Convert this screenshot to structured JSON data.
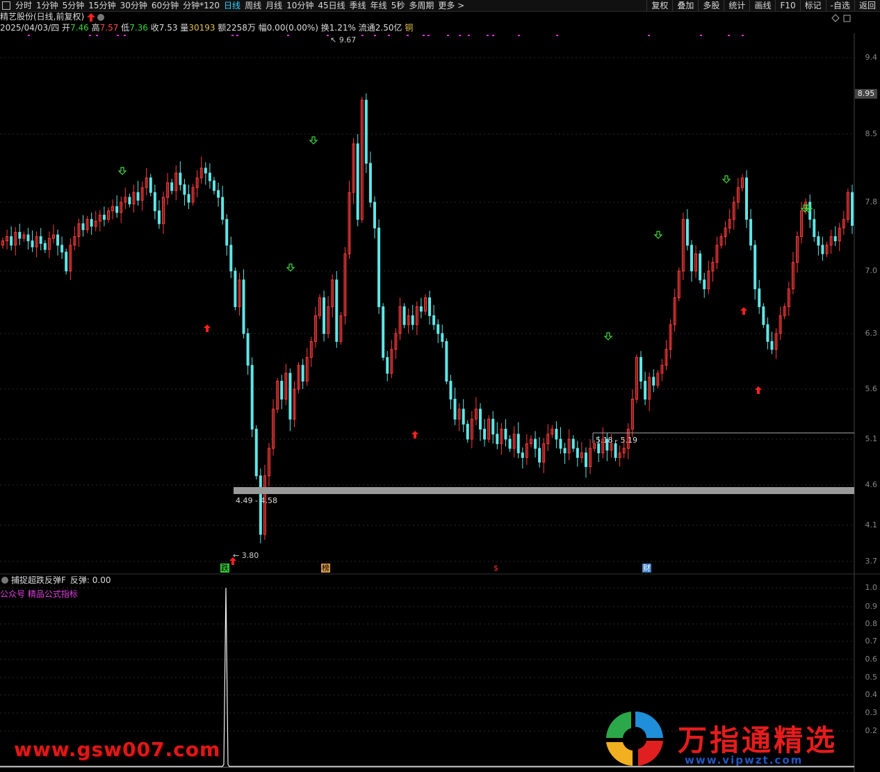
{
  "toolbar": {
    "left_items": [
      "分时",
      "1分钟",
      "5分钟",
      "15分钟",
      "30分钟",
      "60分钟",
      "分钟*120",
      "日线",
      "周线",
      "月线",
      "10分钟",
      "45日线",
      "季线",
      "年线",
      "5秒",
      "多周期",
      "更多 >"
    ],
    "active": "日线",
    "right_items": [
      "复权",
      "叠加",
      "多股",
      "统计",
      "画线",
      "F10",
      "标记",
      "-自选",
      "返回"
    ]
  },
  "title": {
    "stock": "精艺股份(日线,前复权)"
  },
  "info": {
    "date": "2025/04/03/四",
    "open_label": "开",
    "open": "7.46",
    "high_label": "高",
    "high": "7.57",
    "low_label": "低",
    "low": "7.36",
    "close_label": "收",
    "close": "7.53",
    "volume_label": "量",
    "volume": "30193",
    "amount_label": "额",
    "amount": "2258万",
    "change_label": "幅",
    "change": "0.00(0.00%)",
    "turnover_label": "换",
    "turnover": "1.21%",
    "float_label": "流通",
    "float": "2.50亿",
    "sector": "铜"
  },
  "price_axis": [
    "9.4",
    "8.5",
    "7.8",
    "7.0",
    "6.3",
    "5.6",
    "5.1",
    "4.6",
    "4.1",
    "3.7"
  ],
  "current_price_tag": "8.95",
  "annotations": {
    "high_marker": "9.67",
    "low_marker": "3.80",
    "zone1_label": "4.49 - 4.58",
    "zone2_label": "5.18 - 5.19"
  },
  "event_markers": [
    "跌",
    "榜",
    "$",
    "财"
  ],
  "lower_panel": {
    "title": "捕捉超跌反弹F",
    "value_label": "反弹: 0.00",
    "subtitle": "公众号 精品公式指标",
    "axis": [
      "1.0",
      "0.9",
      "0.8",
      "0.7",
      "0.6",
      "0.5",
      "0.4",
      "0.3",
      "0.2"
    ]
  },
  "watermarks": {
    "left": "www.gsw007.com",
    "right": "万指通精选",
    "url": "www.vipwzt.com"
  },
  "chart_data": {
    "type": "candlestick",
    "ylim": [
      3.6,
      9.7
    ],
    "up_color": "#ff3b3b",
    "down_color": "#5fe6e6",
    "closes": [
      7.35,
      7.4,
      7.3,
      7.45,
      7.38,
      7.42,
      7.35,
      7.28,
      7.4,
      7.32,
      7.25,
      7.38,
      7.42,
      7.3,
      7.22,
      7.0,
      7.3,
      7.4,
      7.55,
      7.48,
      7.6,
      7.52,
      7.58,
      7.65,
      7.6,
      7.7,
      7.75,
      7.68,
      7.8,
      7.85,
      7.78,
      7.9,
      7.82,
      7.95,
      8.05,
      7.9,
      7.7,
      7.55,
      7.85,
      8.0,
      7.92,
      8.1,
      7.98,
      7.88,
      7.8,
      7.95,
      8.05,
      8.15,
      8.1,
      8.02,
      7.92,
      7.85,
      7.6,
      7.3,
      7.0,
      6.6,
      6.9,
      6.3,
      5.9,
      5.2,
      4.7,
      4.0,
      4.7,
      5.0,
      5.4,
      5.7,
      5.5,
      5.8,
      5.3,
      5.6,
      5.9,
      5.7,
      6.0,
      6.2,
      6.5,
      6.7,
      6.3,
      6.6,
      6.9,
      6.2,
      6.5,
      7.2,
      7.9,
      8.4,
      7.6,
      8.9,
      8.2,
      7.8,
      7.5,
      6.6,
      6.0,
      5.8,
      6.1,
      6.3,
      6.6,
      6.4,
      6.5,
      6.4,
      6.6,
      6.55,
      6.7,
      6.5,
      6.4,
      6.3,
      6.2,
      5.7,
      5.5,
      5.3,
      5.4,
      5.25,
      5.1,
      5.3,
      5.4,
      5.2,
      5.1,
      5.3,
      5.15,
      5.05,
      5.2,
      5.1,
      5.0,
      5.15,
      4.95,
      4.9,
      5.05,
      5.1,
      5.0,
      4.85,
      5.05,
      5.15,
      5.2,
      5.1,
      5.0,
      4.95,
      5.1,
      5.0,
      4.9,
      4.95,
      4.8,
      5.0,
      5.05,
      4.95,
      5.1,
      4.98,
      5.05,
      4.9,
      4.95,
      5.0,
      5.2,
      5.5,
      6.0,
      5.7,
      5.5,
      5.75,
      5.65,
      5.8,
      5.9,
      6.1,
      6.4,
      6.7,
      7.0,
      7.6,
      7.3,
      7.0,
      7.2,
      6.9,
      6.8,
      7.0,
      7.1,
      7.3,
      7.4,
      7.5,
      7.6,
      7.8,
      7.95,
      8.05,
      7.6,
      7.3,
      6.8,
      6.6,
      6.4,
      6.2,
      6.1,
      6.3,
      6.5,
      6.6,
      6.8,
      7.1,
      7.4,
      7.7,
      7.8,
      7.6,
      7.4,
      7.3,
      7.2,
      7.3,
      7.4,
      7.35,
      7.5,
      7.6,
      7.9,
      7.53
    ]
  }
}
